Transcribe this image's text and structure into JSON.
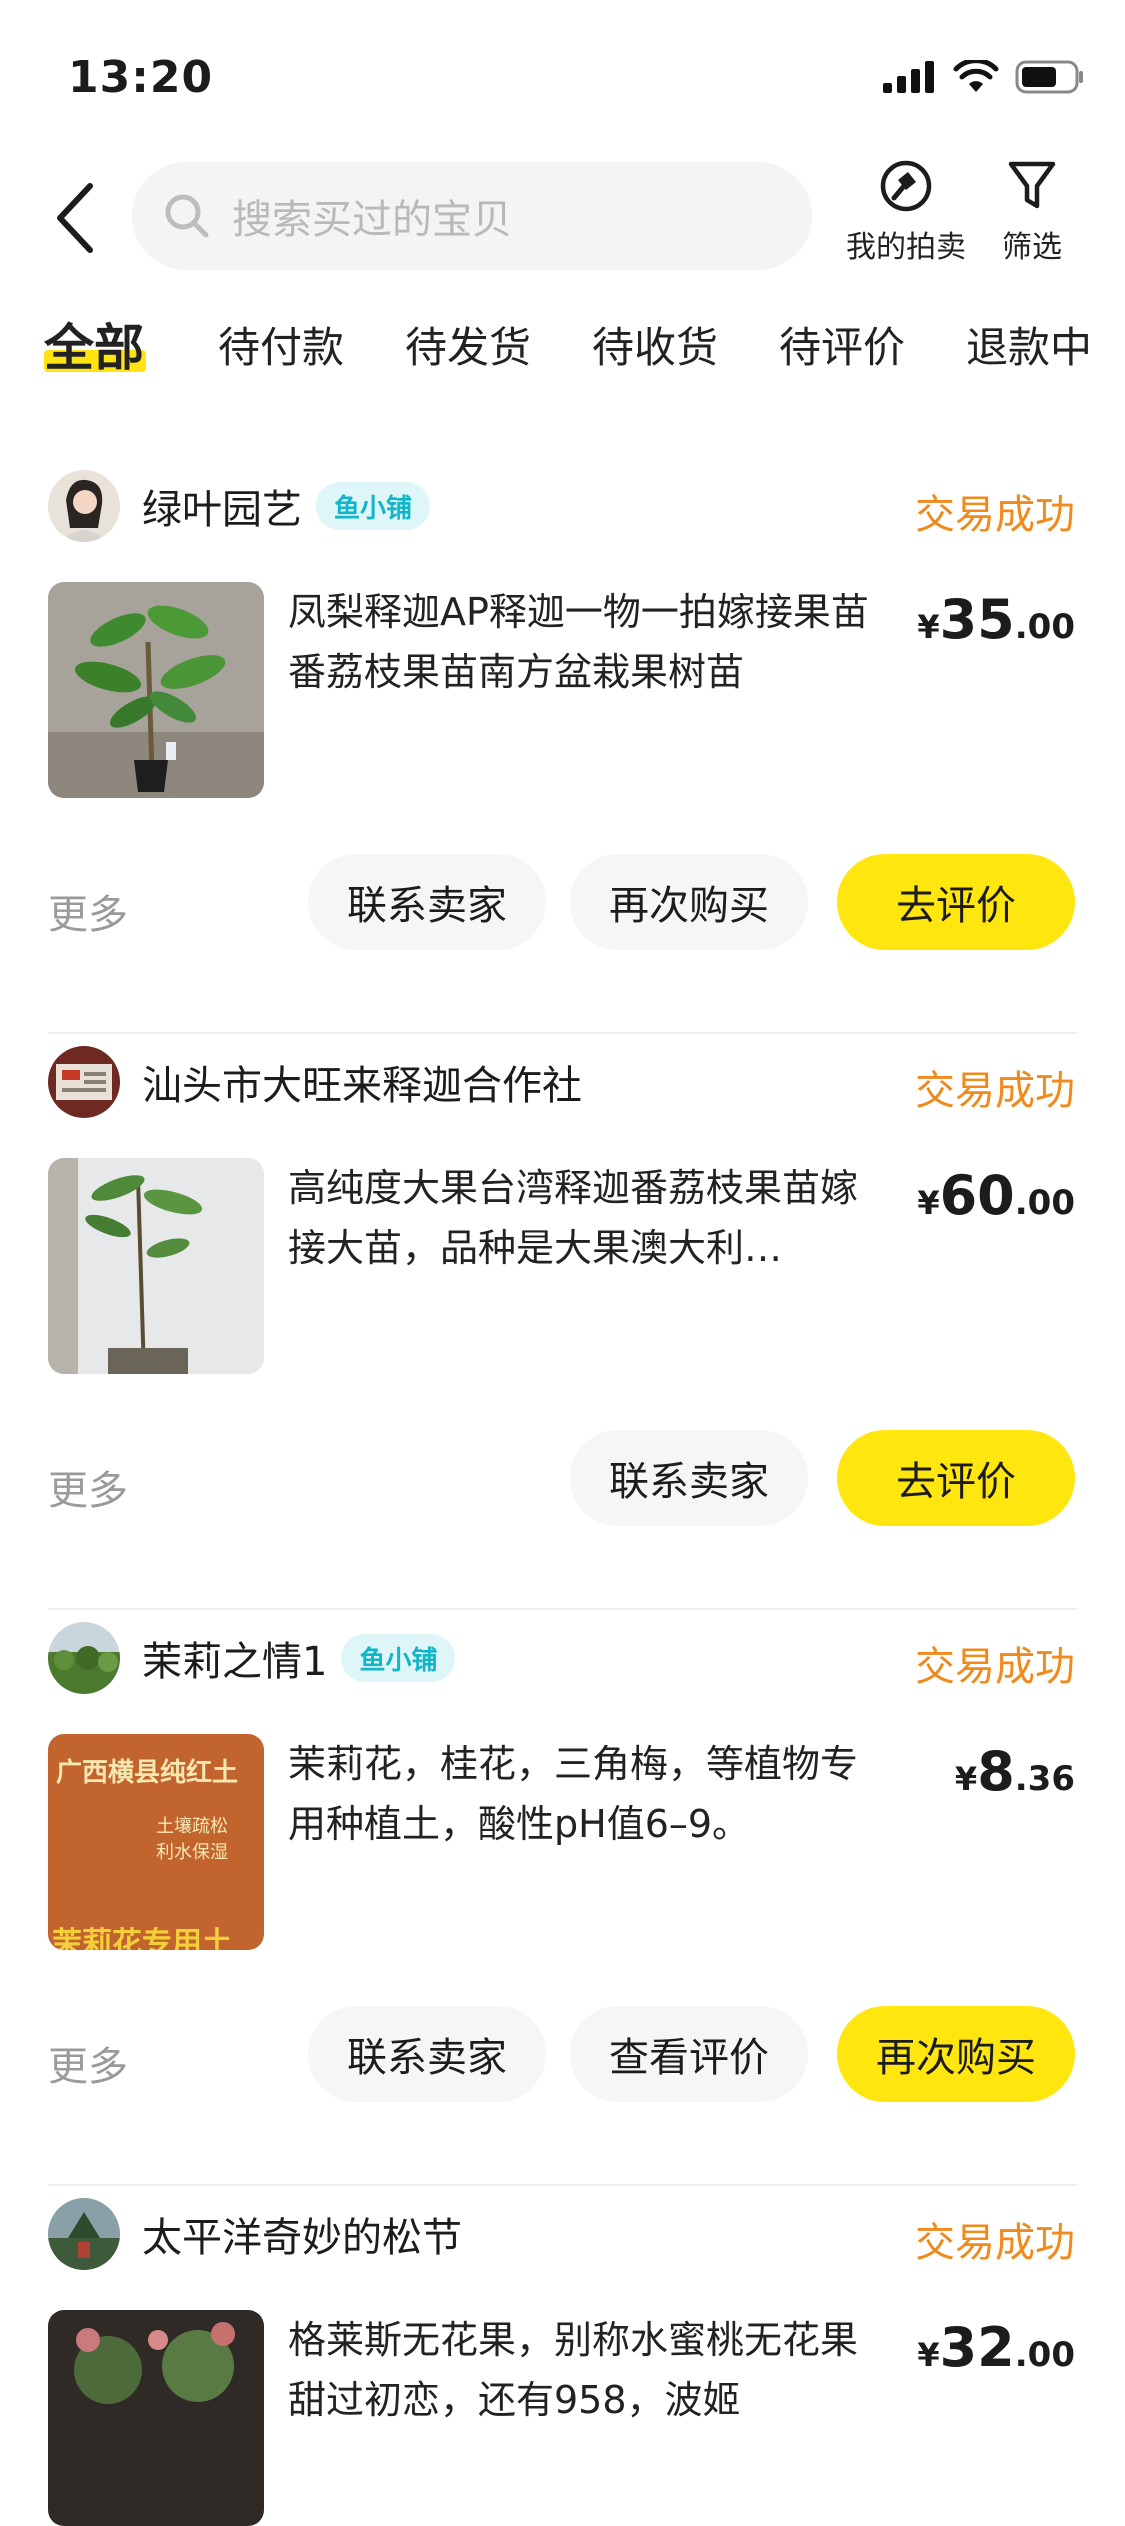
{
  "status_bar": {
    "time": "13:20"
  },
  "header": {
    "search_placeholder": "搜索买过的宝贝",
    "my_auction_label": "我的拍卖",
    "filter_label": "筛选"
  },
  "tabs": [
    "全部",
    "待付款",
    "待发货",
    "待收货",
    "待评价",
    "退款中"
  ],
  "more_label": "更多",
  "orders": [
    {
      "shop": "绿叶园艺",
      "badge": "鱼小铺",
      "status": "交易成功",
      "title": "凤梨释迦AP释迦一物一拍嫁接果苗番荔枝果苗南方盆栽果树苗",
      "price_currency": "¥",
      "price_int": "35",
      "price_dec": ".00",
      "buttons": [
        "联系卖家",
        "再次购买",
        "去评价"
      ]
    },
    {
      "shop": "汕头市大旺来释迦合作社",
      "badge": "",
      "status": "交易成功",
      "title": "高纯度大果台湾释迦番荔枝果苗嫁接大苗，品种是大果澳大利…",
      "price_currency": "¥",
      "price_int": "60",
      "price_dec": ".00",
      "buttons": [
        "联系卖家",
        "去评价"
      ]
    },
    {
      "shop": "茉莉之情1",
      "badge": "鱼小铺",
      "status": "交易成功",
      "title": "茉莉花，桂花，三角梅，等植物专用种植土，酸性pH值6–9。",
      "price_currency": "¥",
      "price_int": "8",
      "price_dec": ".36",
      "thumb_text": "广西横县纯红土",
      "thumb_sub": "土壤疏松 利水保湿",
      "thumb_bottom": "茉莉花专用土",
      "buttons": [
        "联系卖家",
        "查看评价",
        "再次购买"
      ]
    },
    {
      "shop": "太平洋奇妙的松节",
      "badge": "",
      "status": "交易成功",
      "title": "格莱斯无花果，别称水蜜桃无花果甜过初恋，还有958，波姬",
      "price_currency": "¥",
      "price_int": "32",
      "price_dec": ".00",
      "buttons": []
    }
  ],
  "colors": {
    "accent_yellow": "#ffe60f",
    "status_orange": "#f08a1c",
    "badge_cyan": "#13b5c8"
  },
  "icons": [
    "back-arrow-icon",
    "search-icon",
    "auction-hammer-icon",
    "filter-funnel-icon",
    "signal-icon",
    "wifi-icon",
    "battery-icon"
  ]
}
